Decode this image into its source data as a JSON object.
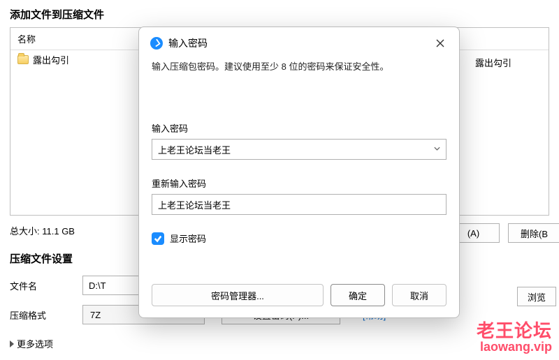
{
  "main": {
    "title": "添加文件到压缩文件",
    "name_header": "名称",
    "file_name": "露出勾引",
    "right_col_text": "露出勾引",
    "total_size_label": "总大小:",
    "total_size_value": "11.1 GB",
    "add_button": "(A)",
    "delete_button": "删除(B"
  },
  "settings": {
    "section_title": "压缩文件设置",
    "filename_label": "文件名",
    "filename_value": "D:\\T",
    "browse_button": "浏览",
    "format_label": "压缩格式",
    "format_value": "7Z",
    "set_password_button": "设置密码(P)...",
    "help_link": "[帮助]",
    "more_options": "更多选项"
  },
  "modal": {
    "title": "输入密码",
    "hint": "输入压缩包密码。建议使用至少 8 位的密码来保证安全性。",
    "password_label": "输入密码",
    "password_value": "上老王论坛当老王",
    "confirm_label": "重新输入密码",
    "confirm_value": "上老王论坛当老王",
    "show_password_label": "显示密码",
    "show_password_checked": true,
    "pwd_manager_button": "密码管理器...",
    "ok_button": "确定",
    "cancel_button": "取消"
  },
  "watermark": {
    "cn": "老王论坛",
    "en": "laowang.vip"
  }
}
